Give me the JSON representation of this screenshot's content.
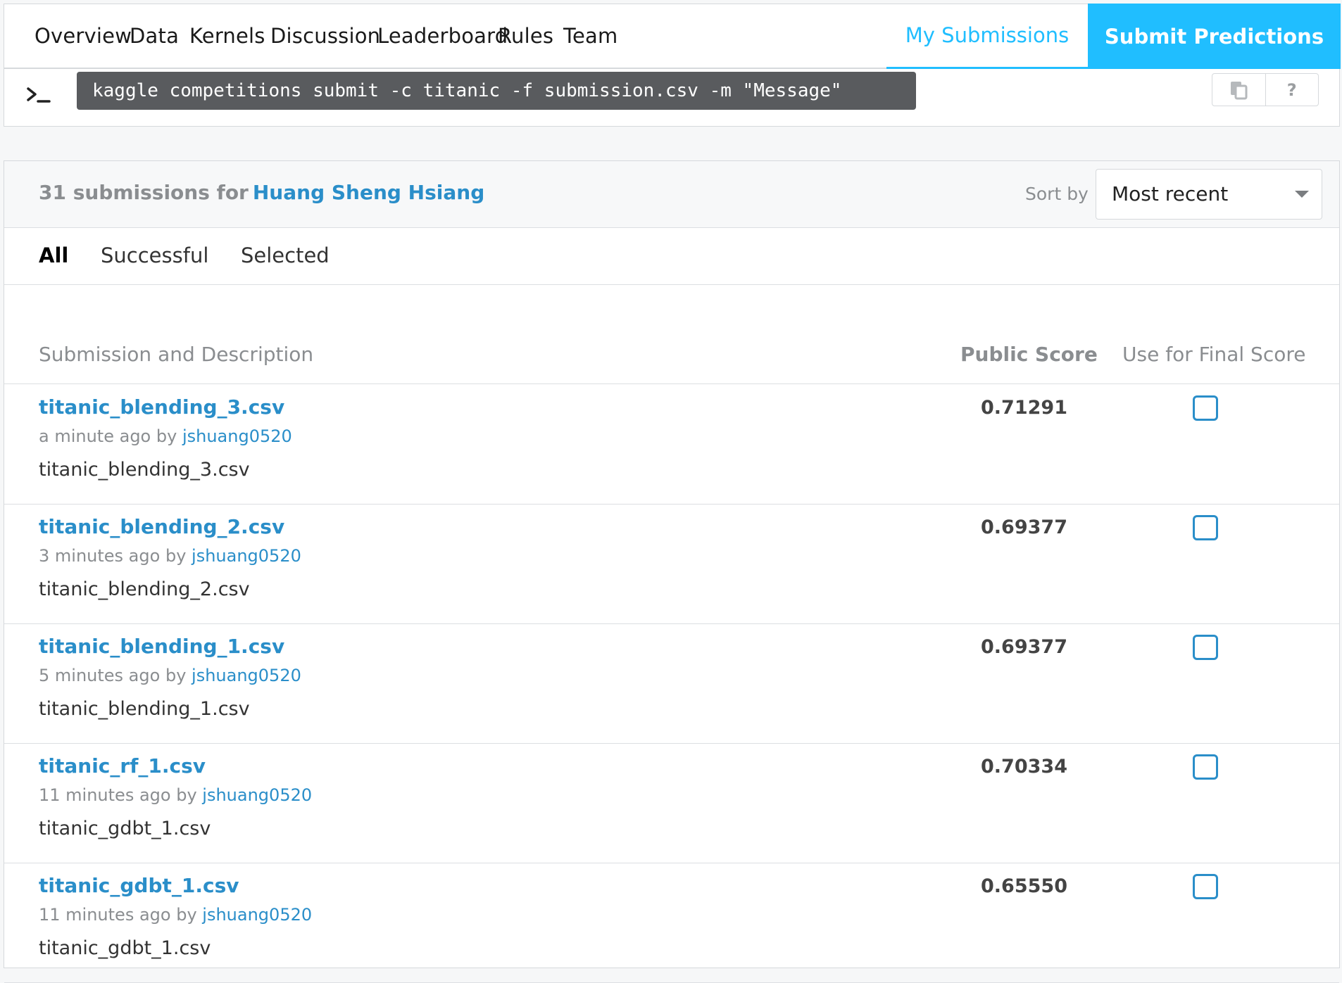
{
  "nav": {
    "items": [
      "Overview",
      "Data",
      "Kernels",
      "Discussion",
      "Leaderboard",
      "Rules",
      "Team"
    ],
    "my_submissions": "My Submissions",
    "submit_predictions": "Submit Predictions"
  },
  "command": {
    "text": "kaggle competitions submit -c titanic -f submission.csv -m \"Message\"",
    "prompt_icon": "terminal-prompt-icon",
    "copy_icon": "copy-icon",
    "help_label": "?"
  },
  "submissions": {
    "count_label": "31 submissions for",
    "user": "Huang Sheng Hsiang",
    "sort_label": "Sort by",
    "sort_value": "Most recent",
    "tabs": [
      "All",
      "Successful",
      "Selected"
    ],
    "active_tab": "All",
    "columns": {
      "description": "Submission and Description",
      "public_score": "Public Score",
      "final_score": "Use for Final Score"
    },
    "by": "by",
    "rows": [
      {
        "title": "titanic_blending_3.csv",
        "time": "a minute ago",
        "author": "jshuang0520",
        "description": "titanic_blending_3.csv",
        "score": "0.71291"
      },
      {
        "title": "titanic_blending_2.csv",
        "time": "3 minutes ago",
        "author": "jshuang0520",
        "description": "titanic_blending_2.csv",
        "score": "0.69377"
      },
      {
        "title": "titanic_blending_1.csv",
        "time": "5 minutes ago",
        "author": "jshuang0520",
        "description": "titanic_blending_1.csv",
        "score": "0.69377"
      },
      {
        "title": "titanic_rf_1.csv",
        "time": "11 minutes ago",
        "author": "jshuang0520",
        "description": "titanic_gdbt_1.csv",
        "score": "0.70334"
      },
      {
        "title": "titanic_gdbt_1.csv",
        "time": "11 minutes ago",
        "author": "jshuang0520",
        "description": "titanic_gdbt_1.csv",
        "score": "0.65550"
      }
    ]
  },
  "colors": {
    "accent": "#20beff",
    "link": "#2a8ec9",
    "command_bg": "#595b5e"
  }
}
